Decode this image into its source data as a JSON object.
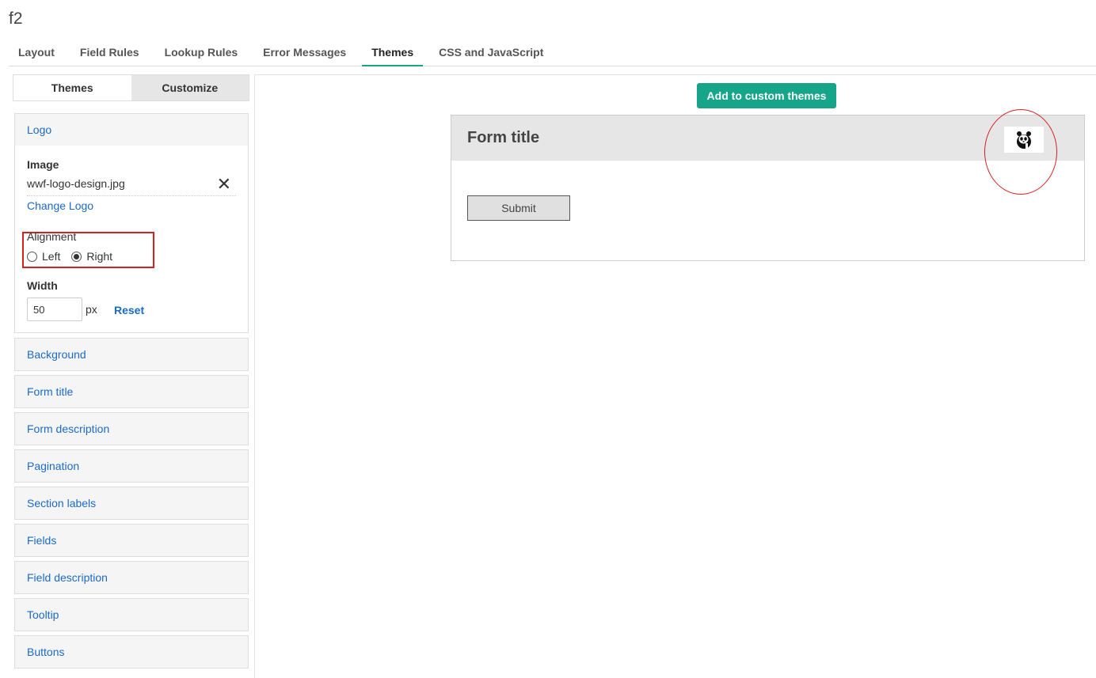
{
  "app": {
    "title": "f2"
  },
  "main_tabs": [
    {
      "label": "Layout"
    },
    {
      "label": "Field Rules"
    },
    {
      "label": "Lookup Rules"
    },
    {
      "label": "Error Messages"
    },
    {
      "label": "Themes",
      "active": true
    },
    {
      "label": "CSS and JavaScript"
    }
  ],
  "sub_tabs": {
    "themes": "Themes",
    "customize": "Customize"
  },
  "logo_panel": {
    "header": "Logo",
    "image_label": "Image",
    "image_filename": "wwf-logo-design.jpg",
    "change_logo": "Change Logo",
    "alignment_label": "Alignment",
    "alignment_options": [
      "Left",
      "Right"
    ],
    "alignment_selected": "Right",
    "width_label": "Width",
    "width_value": "50",
    "width_unit": "px",
    "reset_label": "Reset"
  },
  "sections": [
    "Background",
    "Form title",
    "Form description",
    "Pagination",
    "Section labels",
    "Fields",
    "Field description",
    "Tooltip",
    "Buttons"
  ],
  "preview": {
    "add_button": "Add to custom themes",
    "form_title": "Form title",
    "submit_label": "Submit"
  },
  "colors": {
    "accent": "#17a589",
    "link": "#1b6ac9",
    "highlight": "#d42020"
  }
}
